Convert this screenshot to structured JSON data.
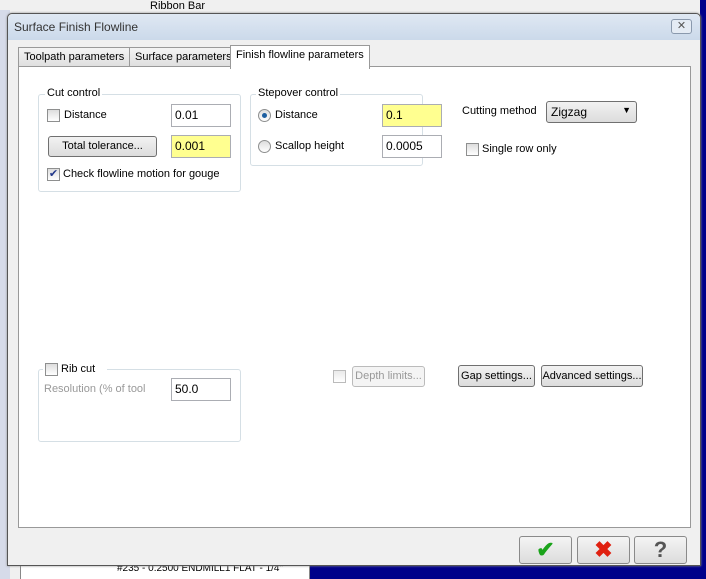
{
  "background": {
    "ribbon_label": "Ribbon Bar",
    "tree_item": "#235 - 0.2500 ENDMILL1 FLAT - 1/4\""
  },
  "dialog": {
    "title": "Surface Finish Flowline",
    "close_icon": "close-icon"
  },
  "tabs": [
    {
      "label": "Toolpath parameters"
    },
    {
      "label": "Surface parameters"
    },
    {
      "label": "Finish flowline parameters",
      "active": true
    }
  ],
  "cut_control": {
    "title": "Cut control",
    "distance_label": "Distance",
    "distance_checked": false,
    "distance_value": "0.01",
    "total_tolerance_button": "Total tolerance...",
    "total_tolerance_value": "0.001",
    "gouge_label": "Check flowline motion for gouge",
    "gouge_checked": true
  },
  "stepover_control": {
    "title": "Stepover control",
    "distance_label": "Distance",
    "distance_selected": true,
    "distance_value": "0.1",
    "scallop_label": "Scallop height",
    "scallop_value": "0.0005"
  },
  "cutting_method": {
    "label": "Cutting method",
    "value": "Zigzag"
  },
  "single_row": {
    "label": "Single row only",
    "checked": false
  },
  "rib_cut": {
    "label": "Rib cut",
    "checked": false,
    "resolution_label": "Resolution (% of tool",
    "resolution_value": "50.0"
  },
  "depth_limits": {
    "label": "Depth limits...",
    "checked": false
  },
  "gap_settings": "Gap settings...",
  "advanced_settings": "Advanced settings...",
  "footer": {
    "ok_icon": "checkmark-icon",
    "cancel_icon": "x-icon",
    "help_icon": "question-icon",
    "ok_color": "#1aa31a",
    "cancel_color": "#e02010"
  }
}
